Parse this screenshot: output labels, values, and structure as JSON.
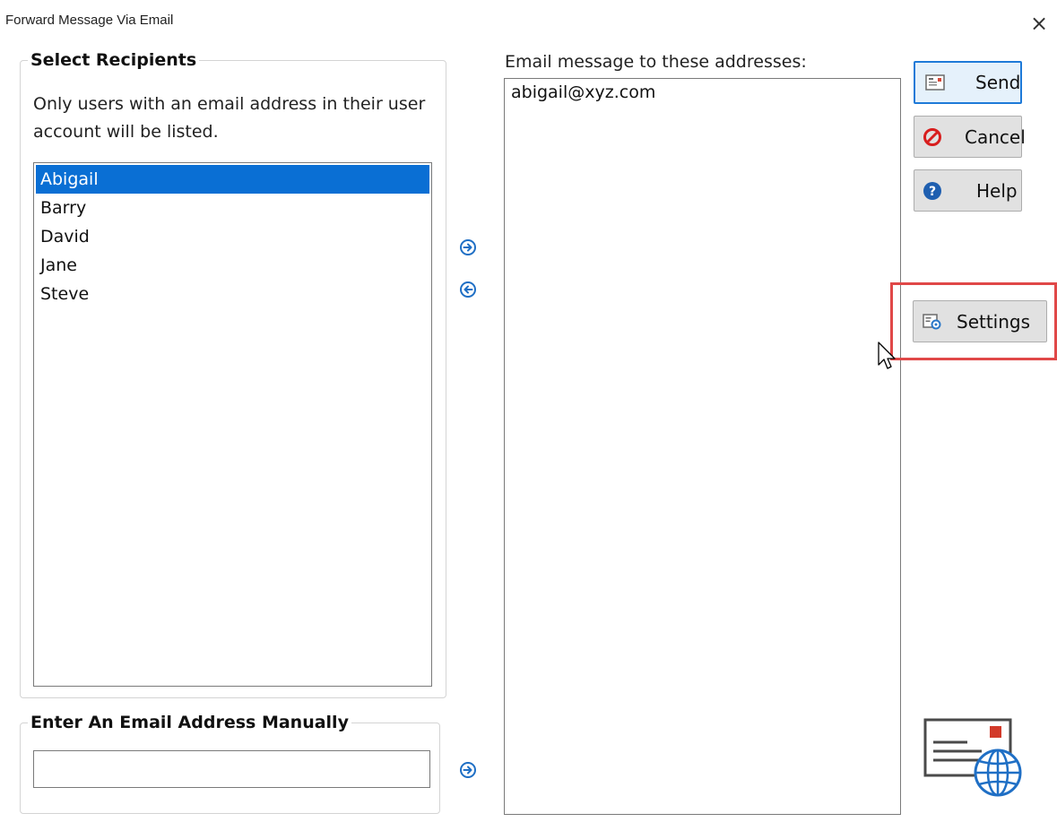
{
  "window": {
    "title": "Forward Message Via Email",
    "close_glyph": "×"
  },
  "recipients": {
    "group_title": "Select Recipients",
    "note": "Only users with an email address in their user account will be listed.",
    "users": [
      {
        "name": "Abigail",
        "selected": true
      },
      {
        "name": "Barry",
        "selected": false
      },
      {
        "name": "David",
        "selected": false
      },
      {
        "name": "Jane",
        "selected": false
      },
      {
        "name": "Steve",
        "selected": false
      }
    ]
  },
  "transfer": {
    "add_icon": "arrow-right-circle-icon",
    "remove_icon": "arrow-left-circle-icon",
    "accent_color": "#1f6fc5"
  },
  "addresses": {
    "label": "Email message to these addresses:",
    "items": [
      "abigail@xyz.com"
    ]
  },
  "buttons": {
    "send": "Send",
    "cancel": "Cancel",
    "help": "Help",
    "settings": "Settings"
  },
  "manual": {
    "group_title": "Enter An Email Address Manually",
    "value": "",
    "placeholder": ""
  },
  "colors": {
    "selection": "#0a6fd4",
    "highlight_box": "#e04848",
    "cancel_icon": "#d81e1e",
    "help_icon": "#1f5fb0"
  }
}
